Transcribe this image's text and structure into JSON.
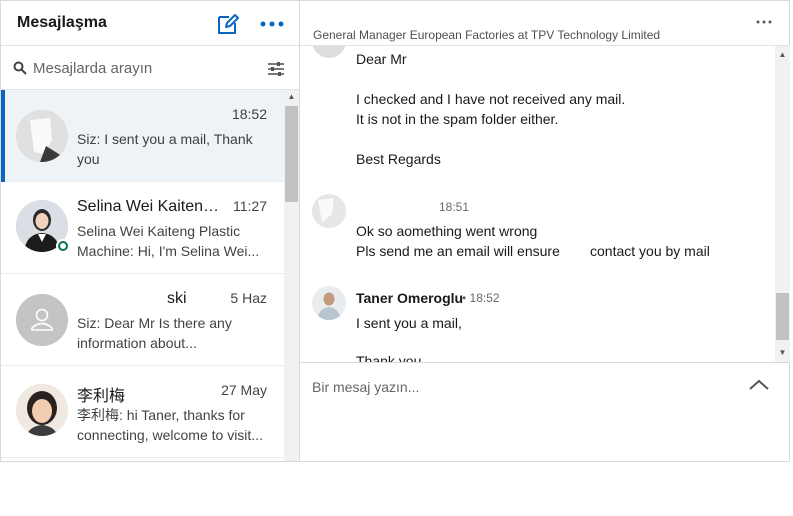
{
  "left_pane": {
    "title": "Mesajlaşma",
    "compose_icon": "compose-icon",
    "more_icon": "more-icon"
  },
  "search": {
    "placeholder": "Mesajlarda arayın",
    "icon": "search-icon",
    "filter_icon": "filter-icon"
  },
  "conversations": [
    {
      "name": "",
      "time": "18:52",
      "snippet": "Siz: I sent you a mail,   Thank you",
      "active": true
    },
    {
      "name": "Selina Wei Kaiteng ...",
      "time": "11:27",
      "snippet": "Selina Wei Kaiteng Plastic Machine: Hi, I'm Selina Wei...",
      "online": true
    },
    {
      "name": "ski",
      "time": "5 Haz",
      "snippet": "Siz: Dear Mr           Is there any information about..."
    },
    {
      "name": "李利梅",
      "time": "27 May",
      "snippet": "李利梅: hi Taner, thanks for connecting, welcome to visit..."
    }
  ],
  "contact": {
    "name": "",
    "headline": "General Manager European Factories at TPV Technology Limited",
    "more_icon": "more-icon"
  },
  "messages": {
    "m1_line1": "Dear Mr",
    "m1_line2": "I checked and I have not received any mail.",
    "m1_line3": "It is not in the spam folder either.",
    "m1_line4": "Best Regards",
    "m2_time": "18:51",
    "m2_line1": "Ok so aomething went wrong",
    "m2_line2": "Pls send me an email will ensure",
    "m2_line2b": "contact you by mail",
    "m3_sender": "Taner Omeroglu",
    "m3_time": "• 18:52",
    "m3_line1": "I sent you a mail,",
    "m3_line2": "Thank you"
  },
  "composer": {
    "placeholder": "Bir mesaj yazın...",
    "expand_icon": "chevron-up-icon"
  },
  "colors": {
    "accent": "#0a66c2",
    "active_bg": "#eef3f8",
    "online": "#057642"
  }
}
